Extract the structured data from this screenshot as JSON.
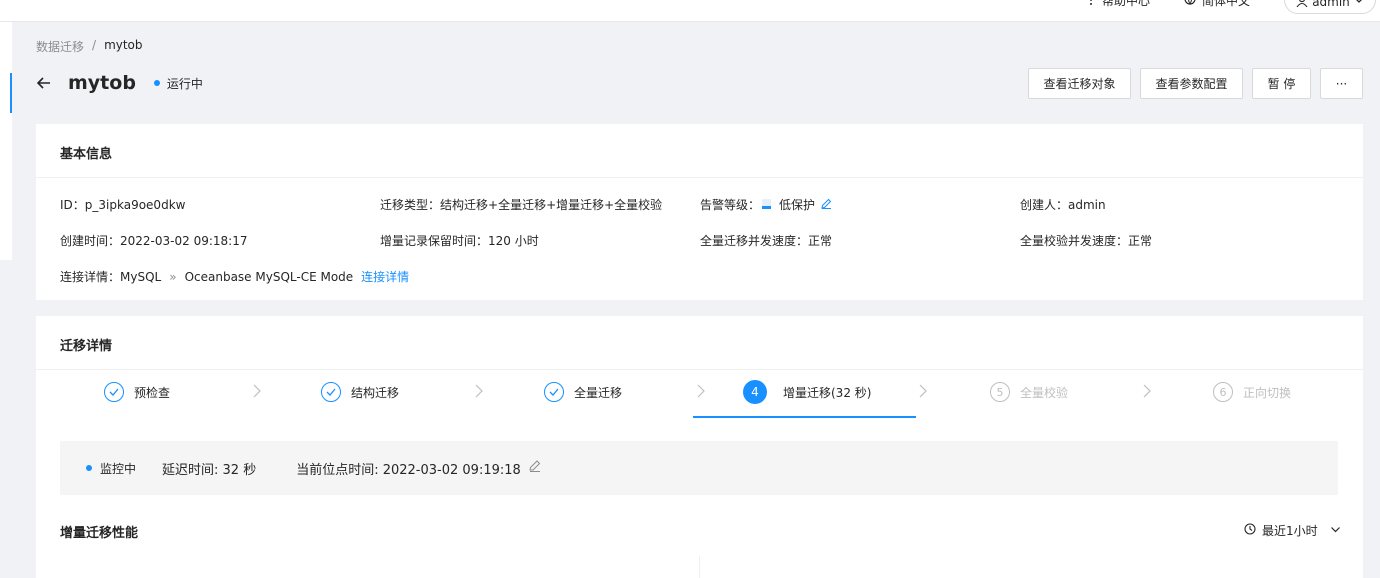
{
  "topbar": {
    "help": "帮助中心",
    "language": "简体中文",
    "user": "admin"
  },
  "breadcrumb": {
    "parent": "数据迁移",
    "separator": "/",
    "current": "mytob"
  },
  "header": {
    "title": "mytob",
    "status": "运行中"
  },
  "actions": {
    "view_objects": "查看迁移对象",
    "view_params": "查看参数配置",
    "pause": "暂 停",
    "more": "···"
  },
  "basic_info": {
    "title": "基本信息",
    "id_label": "ID：",
    "id_value": "p_3ipka9oe0dkw",
    "type_label": "迁移类型：",
    "type_value": "结构迁移+全量迁移+增量迁移+全量校验",
    "alarm_label": "告警等级：",
    "alarm_value": "低保护",
    "creator_label": "创建人：",
    "creator_value": "admin",
    "created_label": "创建时间：",
    "created_value": "2022-03-02 09:18:17",
    "retention_label": "增量记录保留时间：",
    "retention_value": "120 小时",
    "full_speed_label": "全量迁移并发速度：",
    "full_speed_value": "正常",
    "check_speed_label": "全量校验并发速度：",
    "check_speed_value": "正常",
    "conn_label": "连接详情：",
    "conn_source": "MySQL",
    "conn_arrow": "»",
    "conn_target": "Oceanbase MySQL-CE Mode",
    "conn_link": "连接详情"
  },
  "migration": {
    "title": "迁移详情",
    "steps": [
      {
        "label": "预检查",
        "state": "done"
      },
      {
        "label": "结构迁移",
        "state": "done"
      },
      {
        "label": "全量迁移",
        "state": "done"
      },
      {
        "label": "增量迁移(32 秒)",
        "state": "active",
        "num": "4"
      },
      {
        "label": "全量校验",
        "state": "todo",
        "num": "5"
      },
      {
        "label": "正向切换",
        "state": "todo",
        "num": "6"
      }
    ],
    "monitor_status": "监控中",
    "delay_label": "延迟时间: 32 秒",
    "position_label": "当前位点时间: 2022-03-02 09:19:18",
    "perf_title": "增量迁移性能",
    "time_range": "最近1小时"
  },
  "colors": {
    "primary": "#1890ff",
    "bg": "#f0f2f5"
  }
}
